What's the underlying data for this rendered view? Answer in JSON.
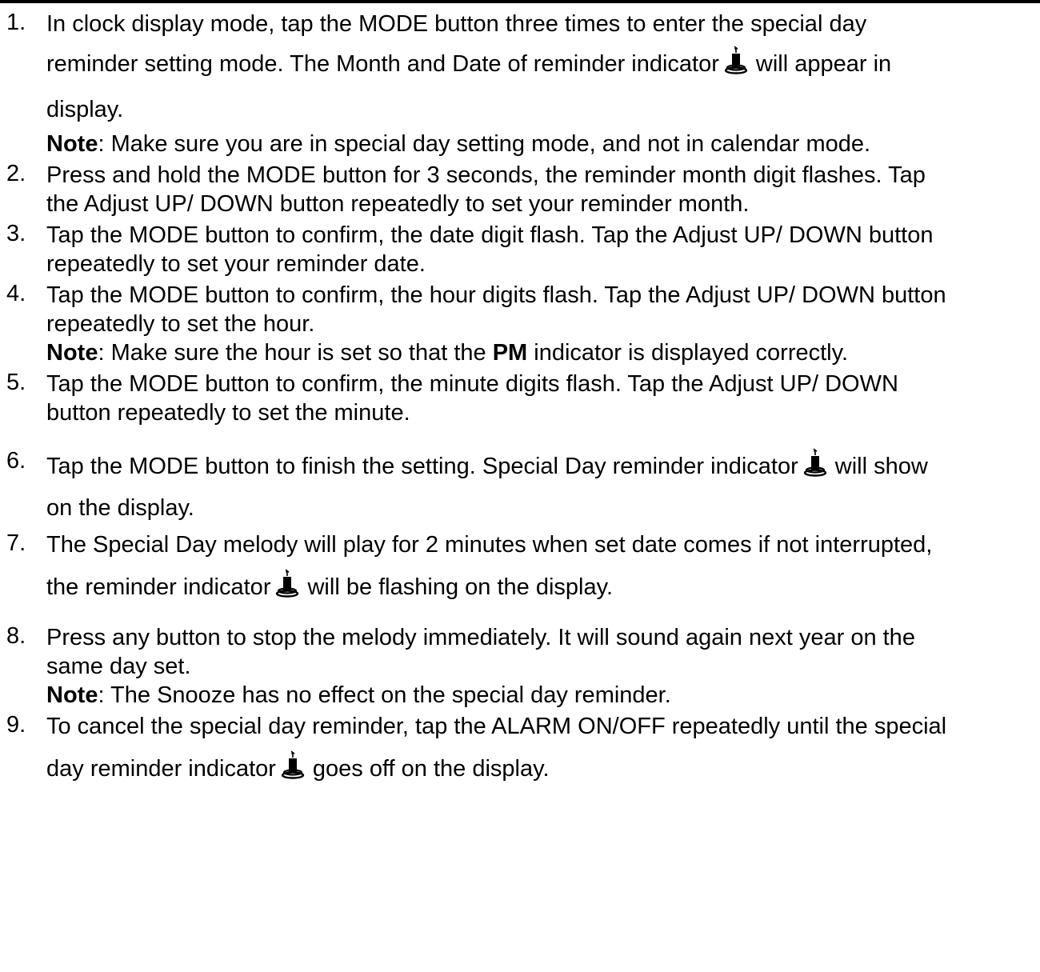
{
  "steps": [
    {
      "number": "1.",
      "text_a": "In clock display mode, tap the MODE button three times to enter the special day",
      "text_b": "reminder setting mode. The Month and Date of reminder indicator",
      "text_c": "will appear in",
      "text_d": "display.",
      "note_label": "Note",
      "note_text": ": Make sure you are in special day setting mode, and not in calendar mode."
    },
    {
      "number": "2.",
      "text_a": "Press and hold the MODE button for 3 seconds, the reminder month digit flashes. Tap",
      "text_b": "the Adjust UP/ DOWN button repeatedly to set your reminder month."
    },
    {
      "number": "3.",
      "text_a": "Tap the MODE button to confirm, the date digit flash. Tap the Adjust UP/ DOWN button",
      "text_b": "repeatedly to set your reminder date."
    },
    {
      "number": "4.",
      "text_a": "Tap the MODE button to confirm, the hour digits flash. Tap the Adjust UP/ DOWN button",
      "text_b": "repeatedly to set the hour.",
      "note_label": "Note",
      "note_text_a": ": Make sure the hour is set so that the ",
      "note_pm": "PM",
      "note_text_b": " indicator is displayed correctly."
    },
    {
      "number": "5.",
      "text_a": "Tap the MODE button to confirm, the minute digits flash. Tap the Adjust UP/ DOWN",
      "text_b": "button repeatedly to set the minute."
    },
    {
      "number": "6.",
      "text_a": "Tap the MODE button to finish the setting. Special Day reminder indicator",
      "text_b": "will show",
      "text_c": "on the display."
    },
    {
      "number": "7.",
      "text_a": "The Special Day melody will play for 2 minutes when set date comes if not interrupted,",
      "text_b": "the reminder indicator",
      "text_c": "will be flashing on the display."
    },
    {
      "number": "8.",
      "text_a": "Press any button to stop the melody immediately. It will sound again next year on the",
      "text_b": "same day set.",
      "note_label": "Note",
      "note_text": ": The Snooze has no effect on the special day reminder."
    },
    {
      "number": "9.",
      "text_a": "To cancel the special day reminder, tap the ALARM ON/OFF repeatedly until the special",
      "text_b": "day reminder indicator",
      "text_c": "goes off on the display."
    }
  ],
  "icons": {
    "reminder": "candle-icon"
  },
  "colors": {
    "text": "#000000",
    "background": "#ffffff"
  }
}
